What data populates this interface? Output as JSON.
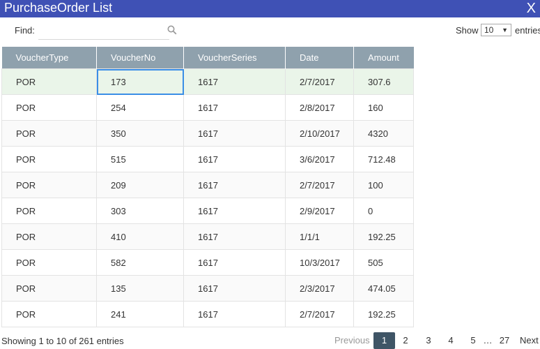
{
  "window": {
    "title": "PurchaseOrder List",
    "close_label": "X"
  },
  "search": {
    "label": "Find:",
    "value": "",
    "placeholder": ""
  },
  "length": {
    "show_label": "Show",
    "value": "10",
    "entries_label": "entries"
  },
  "table": {
    "columns": [
      "VoucherType",
      "VoucherNo",
      "VoucherSeries",
      "Date",
      "Amount"
    ],
    "rows": [
      [
        "POR",
        "173",
        "1617",
        "2/7/2017",
        "307.6"
      ],
      [
        "POR",
        "254",
        "1617",
        "2/8/2017",
        "160"
      ],
      [
        "POR",
        "350",
        "1617",
        "2/10/2017",
        "4320"
      ],
      [
        "POR",
        "515",
        "1617",
        "3/6/2017",
        "712.48"
      ],
      [
        "POR",
        "209",
        "1617",
        "2/7/2017",
        "100"
      ],
      [
        "POR",
        "303",
        "1617",
        "2/9/2017",
        "0"
      ],
      [
        "POR",
        "410",
        "1617",
        "1/1/1",
        "192.25"
      ],
      [
        "POR",
        "582",
        "1617",
        "10/3/2017",
        "505"
      ],
      [
        "POR",
        "135",
        "1617",
        "2/3/2017",
        "474.05"
      ],
      [
        "POR",
        "241",
        "1617",
        "2/7/2017",
        "192.25"
      ]
    ]
  },
  "footer": {
    "info": "Showing 1 to 10 of 261 entries",
    "pager": {
      "previous": "Previous",
      "pages": [
        "1",
        "2",
        "3",
        "4",
        "5"
      ],
      "ellipsis": "…",
      "last": "27",
      "next": "Next",
      "current": "1"
    }
  },
  "colors": {
    "titlebar": "#3f51b5",
    "header": "#8fa1ad",
    "selected_row": "#eaf5e9",
    "focus_outline": "#3a8ee6",
    "active_page": "#3f5566"
  },
  "icons": {
    "search": "search-icon",
    "close": "close-icon",
    "dropdown": "chevron-down-icon"
  }
}
